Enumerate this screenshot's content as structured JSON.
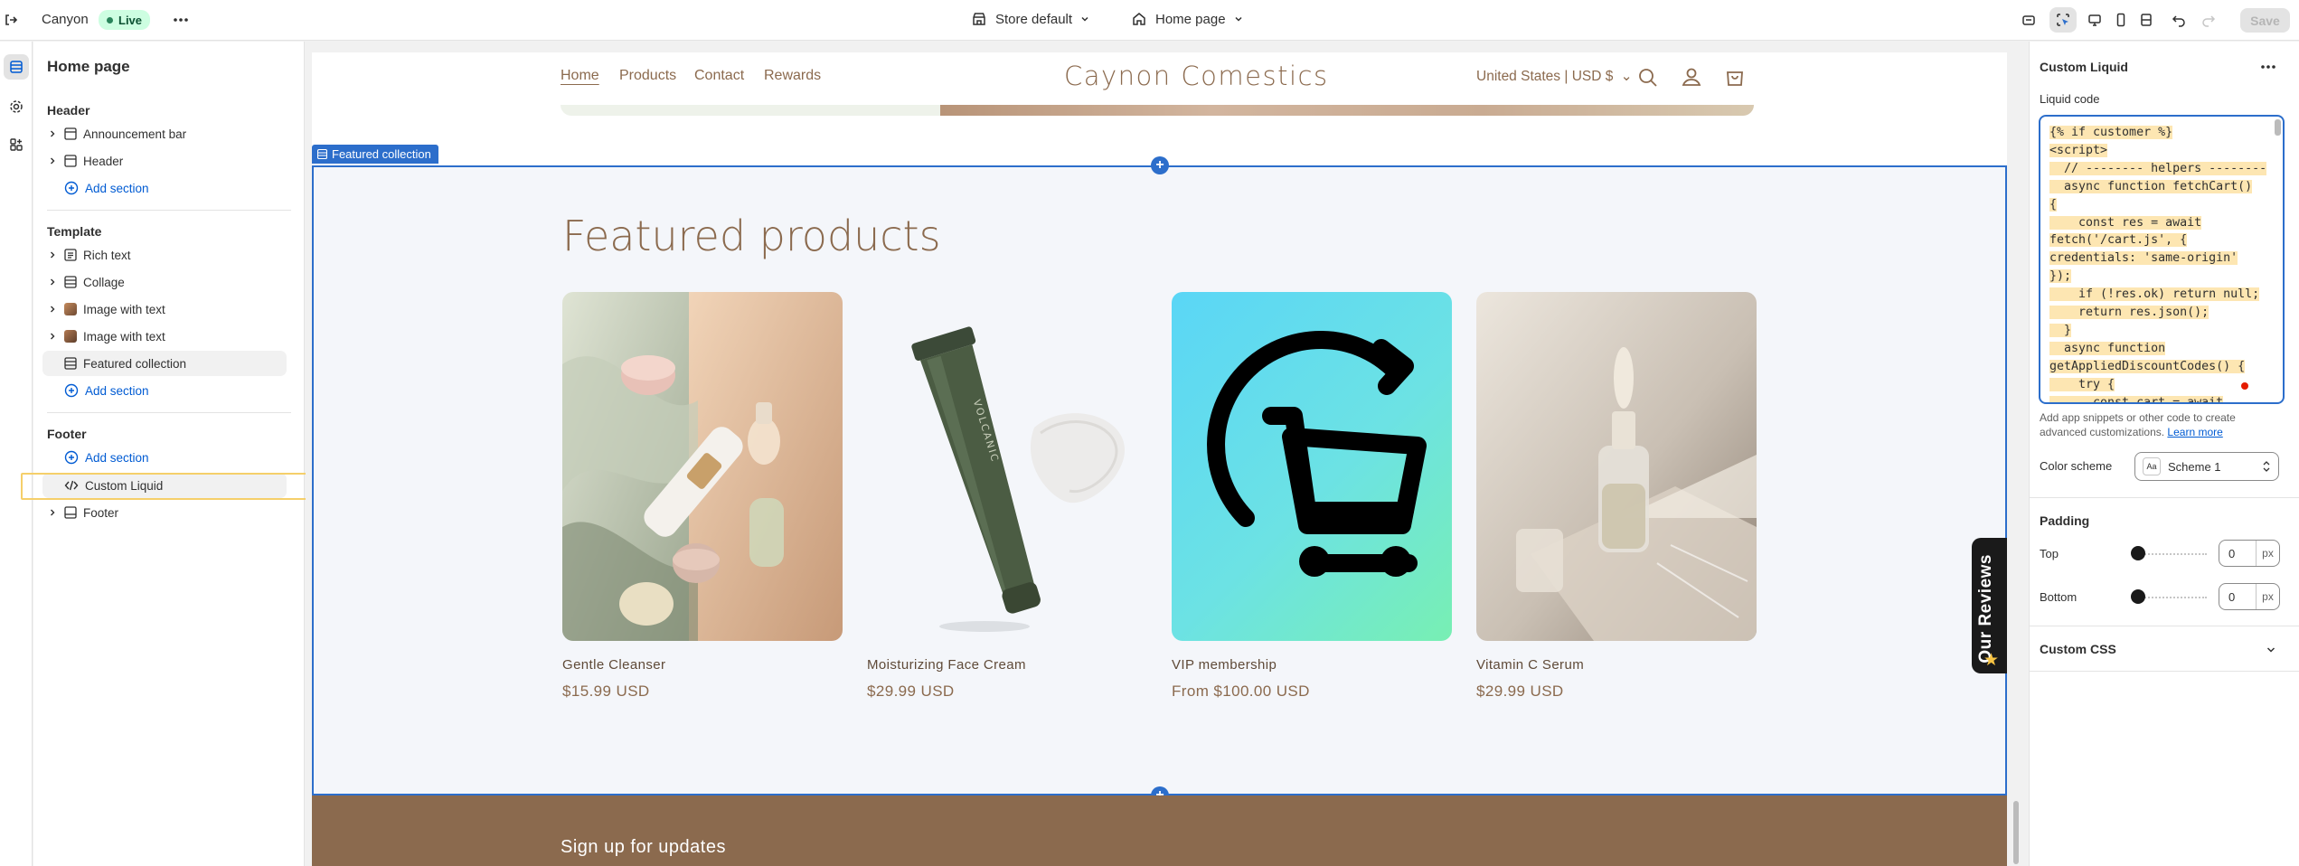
{
  "topbar": {
    "store_name": "Canyon",
    "live_badge": "Live",
    "theme_select": "Store default",
    "page_select": "Home page",
    "save_label": "Save"
  },
  "left_panel": {
    "title": "Home page",
    "header_group": "Header",
    "header_items": [
      "Announcement bar",
      "Header"
    ],
    "add_section": "Add section",
    "template_group": "Template",
    "template_items": [
      "Rich text",
      "Collage",
      "Image with text",
      "Image with text",
      "Featured collection"
    ],
    "footer_group": "Footer",
    "custom_liquid": "Custom Liquid",
    "footer_item": "Footer"
  },
  "storefront": {
    "nav": [
      "Home",
      "Products",
      "Contact",
      "Rewards"
    ],
    "brand": "Caynon Comestics",
    "currency": "United States | USD $",
    "section_tag": "Featured collection",
    "featured_title": "Featured products",
    "products": [
      {
        "name": "Gentle Cleanser",
        "price": "$15.99 USD"
      },
      {
        "name": "Moisturizing Face Cream",
        "price": "$29.99 USD"
      },
      {
        "name": "VIP membership",
        "price": "From $100.00 USD"
      },
      {
        "name": "Vitamin C Serum",
        "price": "$29.99 USD"
      }
    ],
    "signup": "Sign up for updates",
    "reviews_tab": "Our Reviews"
  },
  "right_panel": {
    "title": "Custom Liquid",
    "code_label": "Liquid code",
    "code_lines": [
      "{% if customer %}",
      "<script>",
      "  // -------- helpers --------",
      "  async function fetchCart()",
      "{",
      "    const res = await",
      "fetch('/cart.js', {",
      "credentials: 'same-origin'",
      "});",
      "    if (!res.ok) return null;",
      "    return res.json();",
      "  }",
      "  async function",
      "getAppliedDiscountCodes() {",
      "    try {",
      "      const cart = await"
    ],
    "hint_text": "Add app snippets or other code to create advanced customizations.",
    "hint_link": "Learn more",
    "color_scheme_label": "Color scheme",
    "color_scheme_value": "Scheme 1",
    "padding_heading": "Padding",
    "top_label": "Top",
    "top_value": "0",
    "bottom_label": "Bottom",
    "bottom_value": "0",
    "unit": "px",
    "custom_css": "Custom CSS"
  },
  "colors": {
    "accent": "#2c6ecb",
    "brand": "#8b6a4e",
    "live": "#cdfee1",
    "highlight": "#f5cf6a"
  }
}
